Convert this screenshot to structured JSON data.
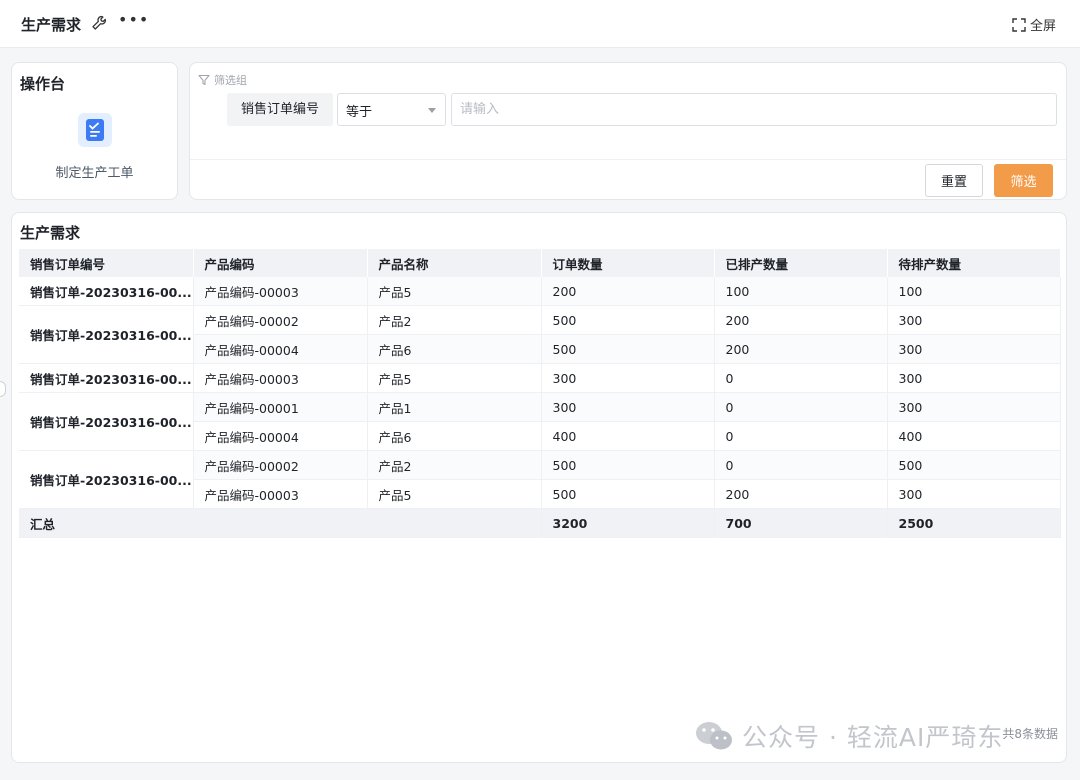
{
  "header": {
    "title": "生产需求",
    "fullscreen_label": "全屏"
  },
  "console": {
    "title": "操作台",
    "action_label": "制定生产工单"
  },
  "filter": {
    "group_label": "筛选组",
    "field_label": "销售订单编号",
    "operator": "等于",
    "input_placeholder": "请输入",
    "reset_label": "重置",
    "submit_label": "筛选"
  },
  "table": {
    "title": "生产需求",
    "columns": [
      "销售订单编号",
      "产品编码",
      "产品名称",
      "订单数量",
      "已排产数量",
      "待排产数量"
    ],
    "groups": [
      {
        "order": "销售订单-20230316-00...",
        "rows": [
          [
            "产品编码-00003",
            "产品5",
            "200",
            "100",
            "100"
          ]
        ]
      },
      {
        "order": "销售订单-20230316-00...",
        "rows": [
          [
            "产品编码-00002",
            "产品2",
            "500",
            "200",
            "300"
          ],
          [
            "产品编码-00004",
            "产品6",
            "500",
            "200",
            "300"
          ]
        ]
      },
      {
        "order": "销售订单-20230316-00...",
        "rows": [
          [
            "产品编码-00003",
            "产品5",
            "300",
            "0",
            "300"
          ]
        ]
      },
      {
        "order": "销售订单-20230316-00...",
        "rows": [
          [
            "产品编码-00001",
            "产品1",
            "300",
            "0",
            "300"
          ],
          [
            "产品编码-00004",
            "产品6",
            "400",
            "0",
            "400"
          ]
        ]
      },
      {
        "order": "销售订单-20230316-00...",
        "rows": [
          [
            "产品编码-00002",
            "产品2",
            "500",
            "0",
            "500"
          ],
          [
            "产品编码-00003",
            "产品5",
            "500",
            "200",
            "300"
          ]
        ]
      }
    ],
    "summary": {
      "label": "汇总",
      "order_qty": "3200",
      "scheduled_qty": "700",
      "pending_qty": "2500"
    },
    "record_count": "共8条数据"
  },
  "watermark": {
    "text": "公众号 · 轻流AI严琦东"
  }
}
